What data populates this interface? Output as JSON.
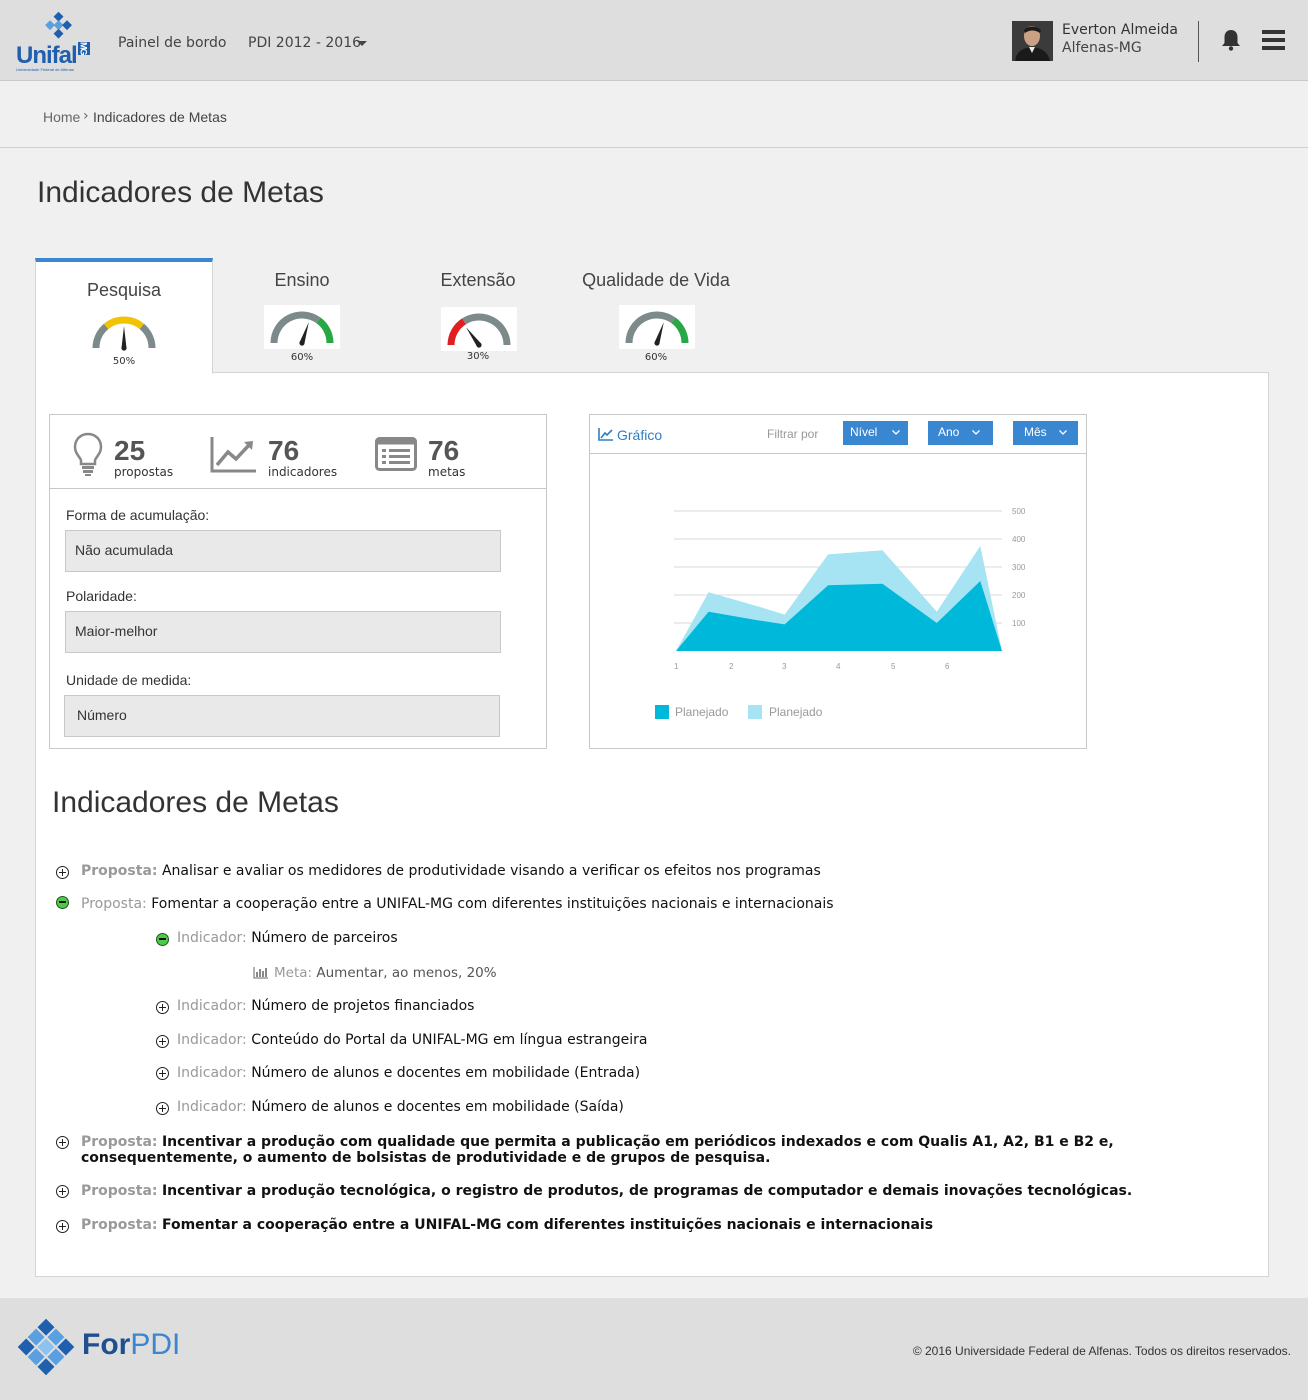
{
  "header": {
    "logo_text": "Unifal",
    "logo_badge": "MG",
    "logo_sub": "Universidade Federal de Alfenas",
    "nav_dashboard": "Painel de bordo",
    "nav_plan": "PDI 2012 - 2016",
    "user_name": "Everton Almeida",
    "user_city": "Alfenas-MG"
  },
  "breadcrumb": {
    "home": "Home",
    "separator": "›",
    "current": "Indicadores de Metas"
  },
  "page_title": "Indicadores de Metas",
  "tabs": [
    {
      "label": "Pesquisa",
      "percent": "50%",
      "level": 0.5,
      "arc_color": "#f2c300"
    },
    {
      "label": "Ensino",
      "percent": "60%",
      "level": 0.6,
      "arc_color": "#28a745"
    },
    {
      "label": "Extensão",
      "percent": "30%",
      "level": 0.3,
      "arc_color": "#e02020"
    },
    {
      "label": "Qualidade de Vida",
      "percent": "60%",
      "level": 0.6,
      "arc_color": "#28a745"
    }
  ],
  "stats": {
    "proposals": {
      "value": "25",
      "label": "propostas",
      "icon": "lightbulb-icon"
    },
    "indicators": {
      "value": "76",
      "label": "indicadores",
      "icon": "line-chart-icon"
    },
    "goals": {
      "value": "76",
      "label": "metas",
      "icon": "list-icon"
    }
  },
  "fields": {
    "accumulation_label": "Forma de acumulação:",
    "accumulation_value": "Não acumulada",
    "polarity_label": "Polaridade:",
    "polarity_value": "Maior-melhor",
    "unit_label": "Unidade de medida:",
    "unit_value": "Número"
  },
  "chart_panel": {
    "title": "Gráfico",
    "filter_label": "Filtrar por",
    "filters": [
      "Nível",
      "Ano",
      "Mês"
    ],
    "colors": {
      "accent": "#3a87d1"
    }
  },
  "chart_data": {
    "type": "area",
    "x": [
      1,
      1.6,
      2.5,
      3,
      3.8,
      4.8,
      5.8,
      6.6,
      7
    ],
    "x_ticks": [
      "1",
      "2",
      "3",
      "4",
      "5",
      "6"
    ],
    "y_ticks": [
      "100",
      "200",
      "300",
      "400",
      "500"
    ],
    "ylim": [
      0,
      500
    ],
    "grid": true,
    "legend_position": "bottom-left",
    "series": [
      {
        "name": "Planejado",
        "color": "#a6e4f3",
        "values": [
          0,
          210,
          160,
          130,
          345,
          360,
          140,
          375,
          0
        ]
      },
      {
        "name": "Planejado",
        "color": "#00b8d9",
        "values": [
          0,
          140,
          110,
          95,
          235,
          240,
          100,
          250,
          0
        ]
      }
    ]
  },
  "tree_title": "Indicadores de Metas",
  "tree": {
    "proposal_key": "Proposta:",
    "indicator_key": "Indicador:",
    "goal_key": "Meta:",
    "p1": "Analisar e avaliar os medidores de produtividade visando a verificar os efeitos nos programas",
    "p2": "Fomentar a cooperação entre a UNIFAL-MG com diferentes instituições nacionais e internacionais",
    "i1": "Número de parceiros",
    "m1": "Aumentar, ao menos, 20%",
    "i2": "Número de projetos financiados",
    "i3": "Conteúdo do Portal da UNIFAL-MG em língua estrangeira",
    "i4": "Número de alunos e docentes em mobilidade (Entrada)",
    "i5": "Número de alunos e docentes em mobilidade (Saída)",
    "p3": "Incentivar a produção com qualidade que permita a publicação em periódicos indexados e com Qualis A1, A2, B1 e B2 e, consequentemente, o aumento de bolsistas de produtividade e de grupos de pesquisa.",
    "p4": "Incentivar a produção tecnológica, o registro de produtos, de programas de computador e demais inovações tecnológicas.",
    "p5": "Fomentar a cooperação entre a UNIFAL-MG com diferentes instituições nacionais e internacionais"
  },
  "footer": {
    "brand_a": "For",
    "brand_b": "PDI",
    "copyright": "© 2016 Universidade Federal de Alfenas. Todos os direitos reservados."
  }
}
